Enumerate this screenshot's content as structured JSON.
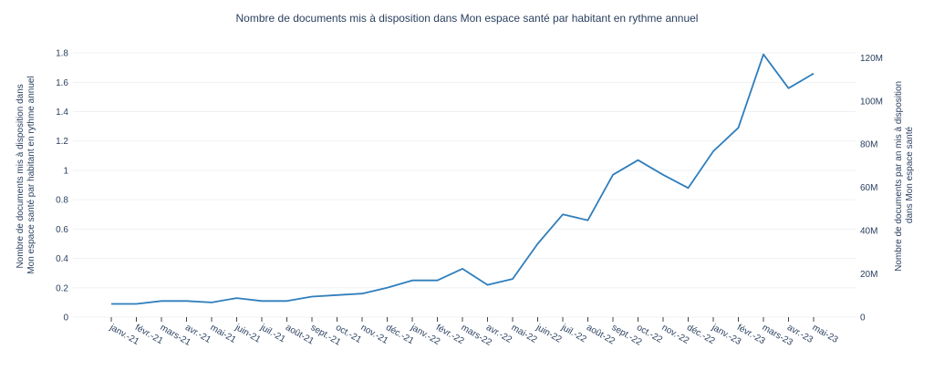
{
  "chart_data": {
    "type": "line",
    "title": "Nombre de documents mis à disposition dans Mon espace santé par habitant en rythme annuel",
    "ylabel_left": [
      "Nombre de documents mis à disposition dans",
      "Mon espace santé par habitant en rythme annuel"
    ],
    "ylabel_right": [
      "Nombre de documents par an mis à disposition",
      "dans Mon espace santé"
    ],
    "categories": [
      "janv.-21",
      "févr.-21",
      "mars-21",
      "avr.-21",
      "mai-21",
      "juin-21",
      "juil.-21",
      "août-21",
      "sept.-21",
      "oct.-21",
      "nov.-21",
      "déc.-21",
      "janv.-22",
      "févr.-22",
      "mars-22",
      "avr.-22",
      "mai-22",
      "juin-22",
      "juil.-22",
      "août-22",
      "sept.-22",
      "oct.-22",
      "nov.-22",
      "déc.-22",
      "janv.-23",
      "févr.-23",
      "mars-23",
      "avr.-23",
      "mai-23"
    ],
    "series": [
      {
        "values": [
          0.09,
          0.09,
          0.11,
          0.11,
          0.1,
          0.13,
          0.11,
          0.11,
          0.14,
          0.15,
          0.16,
          0.2,
          0.25,
          0.25,
          0.33,
          0.22,
          0.26,
          0.5,
          0.7,
          0.66,
          0.97,
          1.07,
          0.97,
          0.88,
          1.13,
          1.29,
          1.79,
          1.56,
          1.66
        ]
      }
    ],
    "ylim_left": [
      0,
      1.9
    ],
    "yticks_left": [
      "0",
      "0.2",
      "0.4",
      "0.6",
      "0.8",
      "1",
      "1.2",
      "1.4",
      "1.6",
      "1.8"
    ],
    "ylim_right": [
      0,
      129000000
    ],
    "yticks_right": [
      "0",
      "20M",
      "40M",
      "60M",
      "80M",
      "100M",
      "120M"
    ],
    "colors": {
      "line": "#2f7ebc",
      "grid": "#eef0f4",
      "text": "#2a3f5f"
    },
    "grid": true
  }
}
